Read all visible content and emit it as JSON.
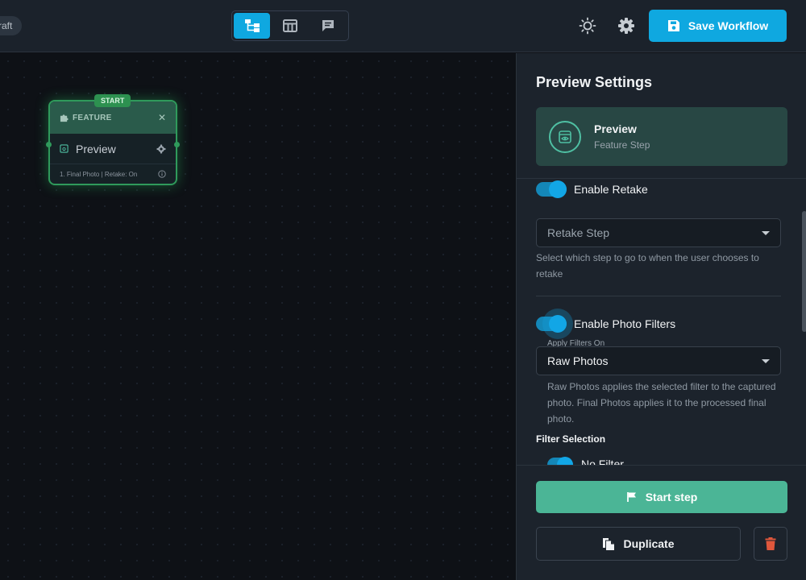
{
  "header": {
    "draft_label": "raft",
    "views": [
      {
        "icon": "workflow-tree-icon",
        "active": true
      },
      {
        "icon": "table-layout-icon",
        "active": false
      },
      {
        "icon": "comment-icon",
        "active": false
      }
    ],
    "theme_icon": "sun-icon",
    "settings_icon": "gear-icon",
    "save_label": "Save Workflow"
  },
  "canvas": {
    "node": {
      "badge": "START",
      "type_label": "FEATURE",
      "step_label": "Preview",
      "summary": "1. Final Photo | Retake: On",
      "border_color": "#2f9a5b"
    }
  },
  "panel": {
    "title": "Preview Settings",
    "step": {
      "name": "Preview",
      "type": "Feature Step"
    },
    "retake": {
      "toggle_label": "Enable Retake",
      "enabled": true,
      "select_placeholder": "Retake Step",
      "helper": "Select which step to go to when the user chooses to retake"
    },
    "filters": {
      "toggle_label": "Enable Photo Filters",
      "enabled": true,
      "select_label": "Apply Filters On",
      "select_value": "Raw Photos",
      "helper": "Raw Photos applies the selected filter to the captured photo. Final Photos applies it to the processed final photo.",
      "section_label": "Filter Selection",
      "first_option": "No Filter"
    },
    "actions": {
      "start_label": "Start step",
      "duplicate_label": "Duplicate"
    }
  },
  "colors": {
    "accent": "#0fa8e0",
    "start_button": "#4bb596",
    "delete": "#e0573c",
    "step_card": "#284744"
  }
}
